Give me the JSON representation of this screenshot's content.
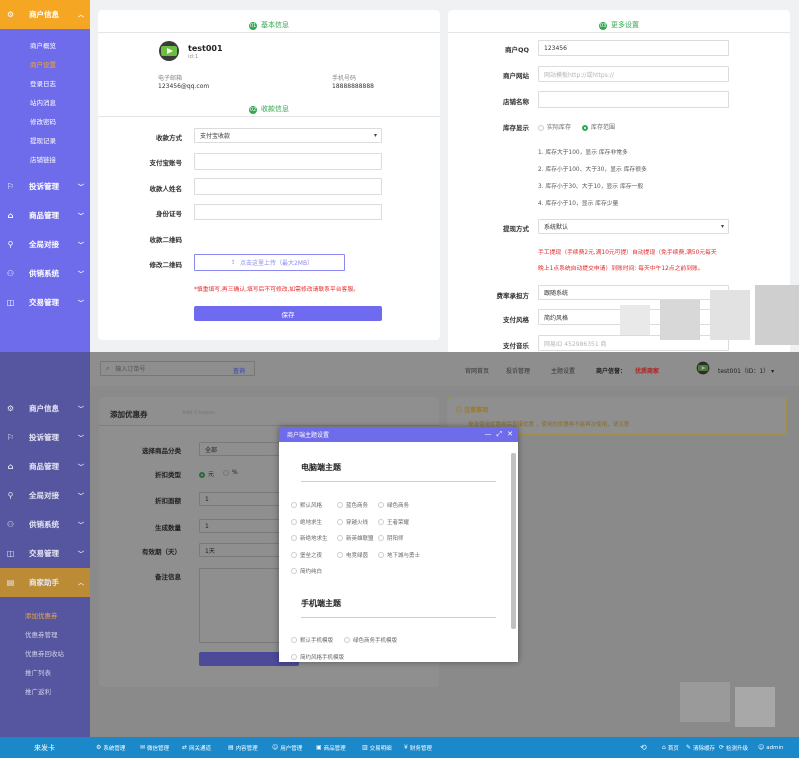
{
  "sidebar_top": {
    "active": "商户信息",
    "subs": [
      "商户概览",
      "商户设置",
      "登录日志",
      "站内消息",
      "修改密码",
      "提现记录",
      "店铺链接"
    ],
    "active_sub": 1,
    "groups": [
      "投诉管理",
      "商品管理",
      "全局对接",
      "供销系统",
      "交易管理"
    ]
  },
  "basic": {
    "title": "基本信息",
    "num": "01",
    "username": "test001",
    "uid": "id:1",
    "email_label": "电子邮箱",
    "email": "123456@qq.com",
    "phone_label": "手机号码",
    "phone": "18888888888"
  },
  "pay": {
    "title": "收款信息",
    "num": "02",
    "method_label": "收款方式",
    "method_value": "支付宝收款",
    "account_label": "支付宝账号",
    "name_label": "收款人姓名",
    "idcard_label": "身份证号",
    "qr_label": "收款二维码",
    "edit_qr_label": "修改二维码",
    "upload_text": "点击这里上传（最大2MB）",
    "notice": "*慎重填写,再三确认,填写后不可修改,如需修改请联系平台客服。",
    "save": "保存"
  },
  "more": {
    "title": "更多设置",
    "num": "03",
    "qq_label": "商户QQ",
    "qq_value": "123456",
    "site_label": "商户网站",
    "site_placeholder": "网站模板http://或https://",
    "shop_label": "店铺名称",
    "stock_label": "库存显示",
    "stock_opt1": "实际库存",
    "stock_opt2": "库存范围",
    "stock_rules": [
      "1. 库存大于100，显示 库存非常多",
      "2. 库存小于100、大于30，显示 库存很多",
      "3. 库存小于30、大于10，显示 库存一般",
      "4. 库存小于10，显示 库存少量"
    ],
    "withdraw_label": "提现方式",
    "withdraw_value": "系统默认",
    "withdraw_notice1": "手工提现（手续费2元,满10元可提）自动提现（免手续费,满50元每天",
    "withdraw_notice2": "晚上1点系统自动提交申请）到账时间: 每天中午12点之前到账。",
    "fee_label": "费率承担方",
    "fee_value": "跟随系统",
    "style_label": "支付风格",
    "style_value": "简约风格",
    "music_label": "支付音乐",
    "music_placeholder": "网易ID 452986351 商"
  },
  "bottom": {
    "search_placeholder": "输入订单号",
    "search_btn": "查询",
    "links": [
      "官网首页",
      "投诉管理",
      "主题设置"
    ],
    "level_label": "商户信誉：",
    "level_value": "优质商家",
    "user": "test001（ID：1）",
    "sidebar": [
      "商户信息",
      "投诉管理",
      "商品管理",
      "全局对接",
      "供销系统",
      "交易管理",
      "商家助手"
    ],
    "sidebar_subs": [
      "添加优惠券",
      "优惠券管理",
      "优惠券回收站",
      "推广列表",
      "推广返利"
    ],
    "coupon_title": "添加优惠券",
    "coupon_sub": "Add Coupon",
    "coupon_rows": [
      {
        "label": "选择商品分类",
        "value": "全部"
      },
      {
        "label": "折扣类型",
        "value": ""
      },
      {
        "label": "折扣面额",
        "value": "1"
      },
      {
        "label": "生成数量",
        "value": "1"
      },
      {
        "label": "有效期（天）",
        "value": "1天"
      },
      {
        "label": "备注信息",
        "value": ""
      }
    ],
    "discount_opt1": "元",
    "discount_opt2": "%",
    "notice_title": "注意事项",
    "notice_text": "单张使用优惠券后直接优惠 ，使用的优惠券不能再次使用，请注意"
  },
  "modal": {
    "title": "商户端主题设置",
    "pc_title": "电脑端主题",
    "pc_options": [
      [
        "默认风格",
        "蓝色商务",
        "绿色商务"
      ],
      [
        "绝地求生",
        "穿越火线",
        "王者荣耀"
      ],
      [
        "新绝地求生",
        "新英雄联盟",
        "阴阳师"
      ],
      [
        "堡垒之夜",
        "电竞绿茵",
        "地下城与勇士"
      ],
      [
        "简约纯白"
      ]
    ],
    "mobile_title": "手机端主题",
    "mobile_options": [
      [
        "默认手机模版",
        "绿色商务手机模版"
      ],
      [
        "简约风格手机模版"
      ]
    ]
  },
  "taskbar": {
    "brand": "来发卡",
    "items": [
      "系统管理",
      "微信管理",
      "网关通道",
      "内容管理",
      "用户管理",
      "商品管理",
      "交易明细",
      "财务管理"
    ],
    "right": [
      "首页",
      "清除缓存",
      "检测升级",
      "admin"
    ]
  }
}
